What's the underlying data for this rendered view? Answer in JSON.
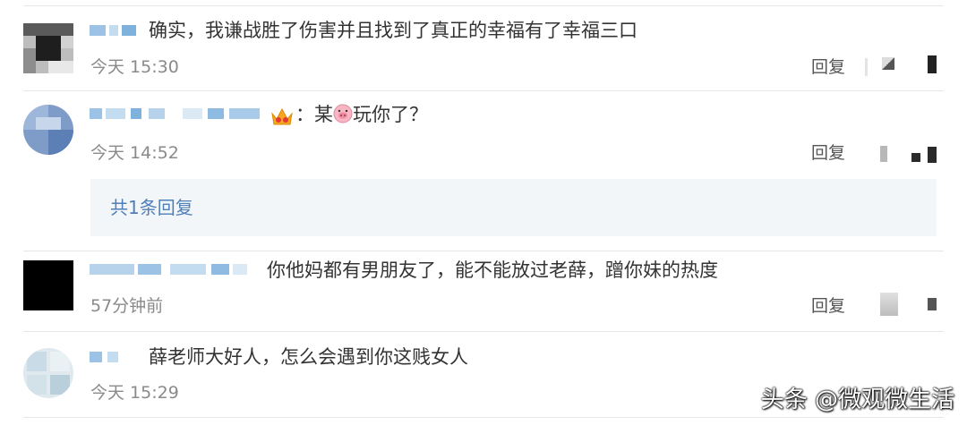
{
  "comments": [
    {
      "text": "确实，我谦战胜了伤害并且找到了真正的幸福有了幸福三口",
      "time": "今天 15:30",
      "reply_label": "回复"
    },
    {
      "prefix": "：",
      "text_before_emoji": "某",
      "text_after_emoji": "玩你了？",
      "time": "今天 14:52",
      "reply_label": "回复",
      "replies_link": "共1条回复"
    },
    {
      "text": "你他妈都有男朋友了，能不能放过老薛，蹭你妹的热度",
      "time": "57分钟前",
      "reply_label": "回复"
    },
    {
      "text": "薛老师大好人，怎么会遇到你这贱女人",
      "time": "今天 15:29"
    }
  ],
  "watermark": "头条 @微观微生活",
  "icons": {
    "crown": "crown-emoji-icon",
    "pig": "pig-emoji-icon",
    "actions": "blurred-action-icon"
  },
  "colors": {
    "link": "#4f7fb8",
    "time": "#8a8a8a",
    "text": "#333333",
    "separator": "#e6e6e6"
  }
}
